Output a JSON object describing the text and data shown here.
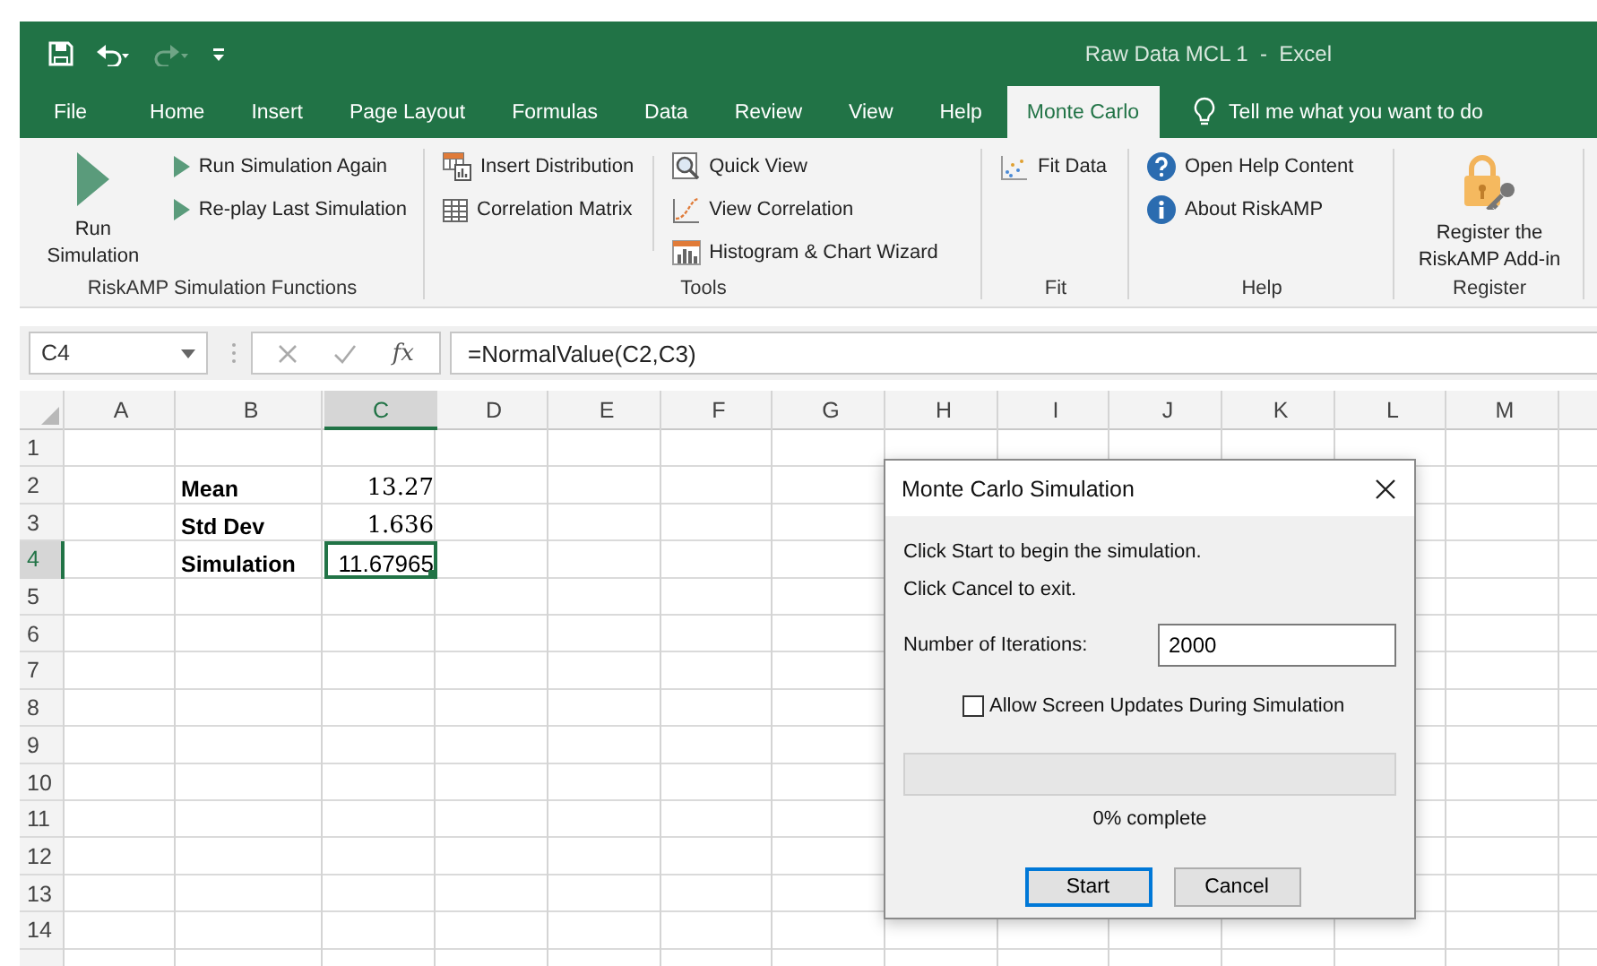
{
  "window": {
    "title": "Raw Data MCL 1  -  Excel"
  },
  "menu_tabs": [
    {
      "label": "File",
      "selected": false
    },
    {
      "label": "Home",
      "selected": false
    },
    {
      "label": "Insert",
      "selected": false
    },
    {
      "label": "Page Layout",
      "selected": false
    },
    {
      "label": "Formulas",
      "selected": false
    },
    {
      "label": "Data",
      "selected": false
    },
    {
      "label": "Review",
      "selected": false
    },
    {
      "label": "View",
      "selected": false
    },
    {
      "label": "Help",
      "selected": false
    },
    {
      "label": "Monte Carlo",
      "selected": true
    }
  ],
  "tell_me": {
    "placeholder": "Tell me what you want to do"
  },
  "ribbon": {
    "groups": [
      {
        "label": "RiskAMP Simulation Functions",
        "columns": [
          [
            {
              "kind": "large",
              "label": "Run Simulation"
            }
          ],
          [
            {
              "kind": "small",
              "label": "Run Simulation Again"
            },
            {
              "kind": "small",
              "label": "Re-play Last Simulation"
            }
          ]
        ]
      },
      {
        "label": "Tools",
        "columns": [
          [
            {
              "kind": "small",
              "label": "Insert Distribution"
            },
            {
              "kind": "small",
              "label": "Correlation Matrix"
            }
          ],
          [
            {
              "kind": "small",
              "label": "Quick View"
            },
            {
              "kind": "small",
              "label": "View Correlation"
            },
            {
              "kind": "small",
              "label": "Histogram & Chart Wizard"
            }
          ]
        ]
      },
      {
        "label": "Fit",
        "columns": [
          [
            {
              "kind": "small",
              "label": "Fit Data"
            }
          ]
        ]
      },
      {
        "label": "Help",
        "columns": [
          [
            {
              "kind": "small",
              "label": "Open Help Content"
            },
            {
              "kind": "small",
              "label": "About RiskAMP"
            }
          ]
        ]
      },
      {
        "label": "Register",
        "columns": [
          [
            {
              "kind": "large",
              "label": "Register the RiskAMP Add-in"
            }
          ]
        ]
      }
    ]
  },
  "formula_bar": {
    "name_box": "C4",
    "function_button": "fx",
    "formula": "=NormalValue(C2,C3)"
  },
  "sheet": {
    "columns": [
      {
        "label": "A",
        "selected": false
      },
      {
        "label": "B",
        "selected": false
      },
      {
        "label": "C",
        "selected": true
      },
      {
        "label": "D",
        "selected": false
      },
      {
        "label": "E",
        "selected": false
      },
      {
        "label": "F",
        "selected": false
      },
      {
        "label": "G",
        "selected": false
      },
      {
        "label": "H",
        "selected": false
      },
      {
        "label": "I",
        "selected": false
      },
      {
        "label": "J",
        "selected": false
      },
      {
        "label": "K",
        "selected": false
      },
      {
        "label": "L",
        "selected": false
      },
      {
        "label": "M",
        "selected": false
      }
    ],
    "rows": [
      {
        "label": "1",
        "selected": false
      },
      {
        "label": "2",
        "selected": false,
        "b": {
          "text": "Mean"
        },
        "c": {
          "text": "13.27",
          "kind": "constant"
        }
      },
      {
        "label": "3",
        "selected": false,
        "b": {
          "text": "Std Dev"
        },
        "c": {
          "text": "1.636",
          "kind": "constant"
        }
      },
      {
        "label": "4",
        "selected": true,
        "b": {
          "text": "Simulation"
        },
        "c": {
          "text": "11.67965",
          "kind": "formula"
        }
      },
      {
        "label": "5",
        "selected": false
      },
      {
        "label": "6",
        "selected": false
      },
      {
        "label": "7",
        "selected": false
      },
      {
        "label": "8",
        "selected": false
      },
      {
        "label": "9",
        "selected": false
      },
      {
        "label": "10",
        "selected": false
      },
      {
        "label": "11",
        "selected": false
      },
      {
        "label": "12",
        "selected": false
      },
      {
        "label": "13",
        "selected": false
      },
      {
        "label": "14",
        "selected": false
      }
    ]
  },
  "dialog": {
    "title": "Monte Carlo Simulation",
    "lines": [
      "Click Start to begin the simulation.",
      "Click Cancel to exit."
    ],
    "iterations": {
      "label": "Number of Iterations:",
      "value": "2000"
    },
    "checkbox": {
      "label": "Allow Screen Updates During Simulation",
      "checked": false
    },
    "progress": {
      "level": 0
    },
    "progress_text": "0% complete",
    "buttons": [
      {
        "label": "Start",
        "default": true
      },
      {
        "label": "Cancel",
        "default": false
      }
    ]
  }
}
